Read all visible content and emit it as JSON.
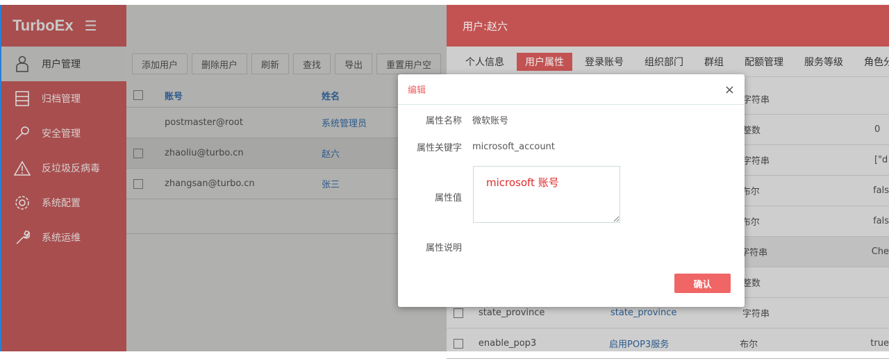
{
  "app": {
    "logo": "TurboEx"
  },
  "sidebar": {
    "items": [
      {
        "label": "用户管理",
        "icon": "user-icon",
        "active": true
      },
      {
        "label": "归档管理",
        "icon": "server-icon"
      },
      {
        "label": "安全管理",
        "icon": "key-icon"
      },
      {
        "label": "反垃圾反病毒",
        "icon": "warning-icon"
      },
      {
        "label": "系统配置",
        "icon": "gear-icon"
      },
      {
        "label": "系统运维",
        "icon": "wrench-icon"
      }
    ]
  },
  "toolbar": {
    "buttons": [
      "添加用户",
      "删除用户",
      "刷新",
      "查找",
      "导出",
      "重置用户空"
    ]
  },
  "users": {
    "headers": [
      "账号",
      "姓名"
    ],
    "rows": [
      {
        "account": "postmaster@root",
        "name": "系统管理员",
        "checkbox": false
      },
      {
        "account": "zhaoliu@turbo.cn",
        "name": "赵六",
        "checkbox": true
      },
      {
        "account": "zhangsan@turbo.cn",
        "name": "张三",
        "checkbox": true
      }
    ]
  },
  "panel": {
    "title": "用户:赵六",
    "tabs": [
      "个人信息",
      "用户属性",
      "登录账号",
      "组织部门",
      "群组",
      "配额管理",
      "服务等级",
      "角色分"
    ],
    "active_tab": 1,
    "rows": [
      {
        "key": "",
        "name": "",
        "type": "字符串",
        "value": ""
      },
      {
        "key": "",
        "name": "",
        "type": "整数",
        "value": "0"
      },
      {
        "key": "",
        "name": "",
        "type": "字符串",
        "value": "[\"d"
      },
      {
        "key": "",
        "name": "",
        "type": "布尔",
        "value": "fals"
      },
      {
        "key": "",
        "name": "",
        "type": "布尔",
        "value": "fals"
      },
      {
        "key": "",
        "name": "",
        "type": "字符串",
        "value": "Che"
      },
      {
        "key": "",
        "name": "",
        "type": "整数",
        "value": ""
      },
      {
        "key": "state_province",
        "name": "state_province",
        "type": "字符串",
        "value": ""
      },
      {
        "key": "enable_pop3",
        "name": "启用POP3服务",
        "type": "布尔",
        "value": "true"
      }
    ]
  },
  "modal": {
    "title": "编辑",
    "close": "×",
    "name_label": "属性名称",
    "name_value": "微软账号",
    "key_label": "属性关键字",
    "key_value": "microsoft_account",
    "value_label": "属性值",
    "value_value": "microsoft 账号",
    "desc_label": "属性说明",
    "confirm": "确认"
  }
}
